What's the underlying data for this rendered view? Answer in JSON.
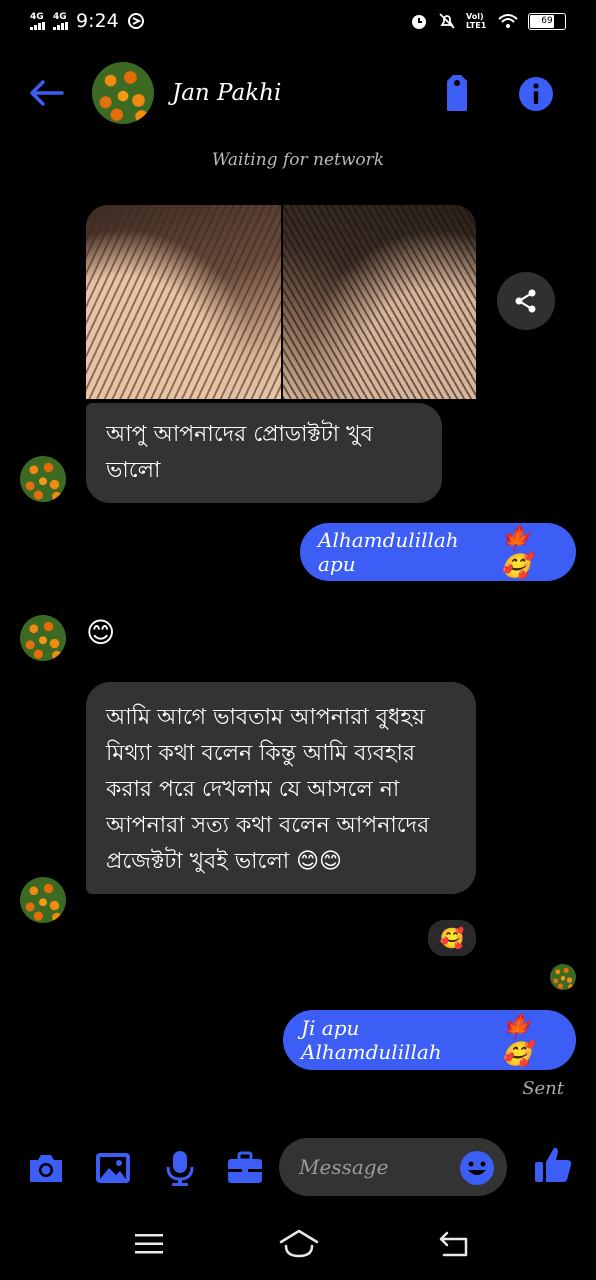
{
  "status_bar": {
    "net1": "4G",
    "net2": "4G",
    "time": "9:24",
    "volte": "Vol) LTE1",
    "battery": "69"
  },
  "header": {
    "contact_name": "Jan Pakhi",
    "network_status": "Waiting for network"
  },
  "messages": {
    "m1": "আপু আপনাদের প্রোডাক্টটা খুব ভালো",
    "m2": "Alhamdulillah apu",
    "m2_emoji": "🍁🥰",
    "m3_emoji": "😊",
    "m4": "আমি আগে ভাবতাম আপনারা বুধহয় মিথ্যা কথা বলেন কিন্তু আমি ব্যবহার করার পরে দেখলাম যে আসলে না আপনারা সত্য কথা বলেন আপনাদের প্রজেক্টটা খুবই ভালো 😊😊",
    "m4_reaction": "🥰",
    "m5": "Ji apu Alhamdulillah",
    "m5_emoji": "🍁🥰",
    "sent_label": "Sent"
  },
  "composer": {
    "placeholder": "Message"
  },
  "colors": {
    "accent": "#3c5ef5",
    "incoming_bubble": "#333334",
    "background": "#000000"
  }
}
